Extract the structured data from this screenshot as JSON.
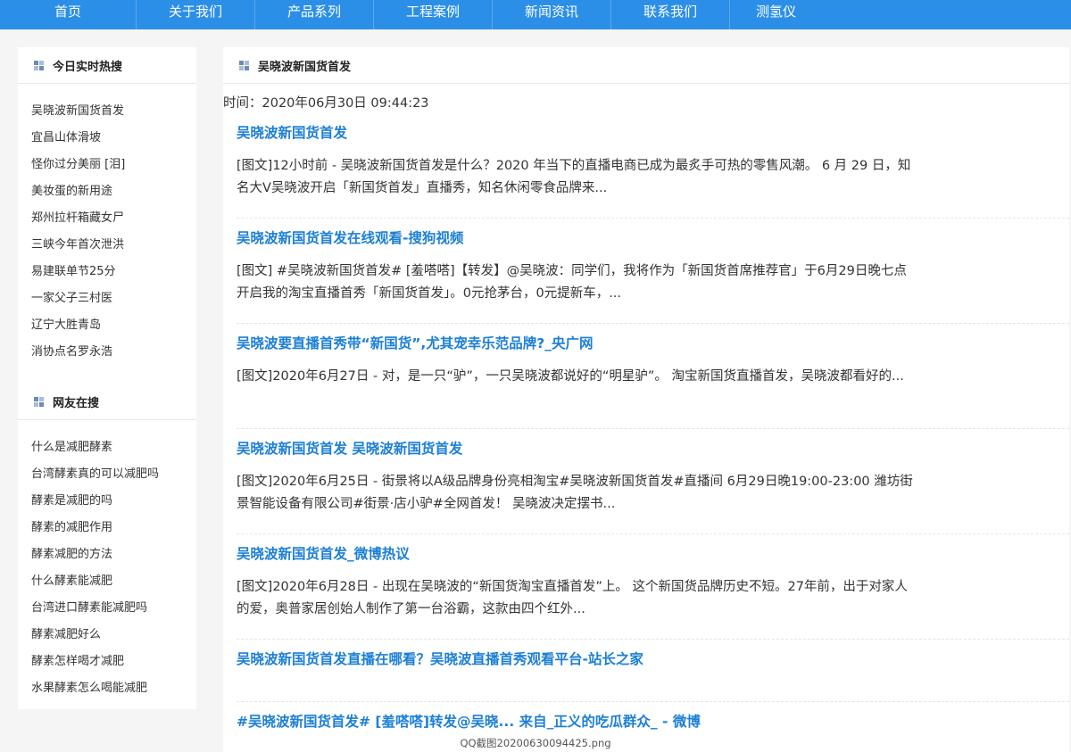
{
  "nav": {
    "items": [
      "首页",
      "关于我们",
      "产品系列",
      "工程案例",
      "新闻资讯",
      "联系我们",
      "测氢仪"
    ]
  },
  "sidebar": {
    "hot_title": "今日实时热搜",
    "hot_items": [
      "吴晓波新国货首发",
      "宜昌山体滑坡",
      "怪你过分美丽 [泪]",
      "美妆蛋的新用途",
      "郑州拉杆箱藏女尸",
      "三峡今年首次泄洪",
      "易建联单节25分",
      "一家父子三村医",
      "辽宁大胜青岛",
      "消协点名罗永浩"
    ],
    "search_title": "网友在搜",
    "search_items": [
      "什么是减肥酵素",
      "台湾酵素真的可以减肥吗",
      "酵素是减肥的吗",
      "酵素的减肥作用",
      "酵素减肥的方法",
      "什么酵素能减肥",
      "台湾进口酵素能减肥吗",
      "酵素减肥好么",
      "酵素怎样喝才减肥",
      "水果酵素怎么喝能减肥"
    ]
  },
  "main": {
    "title": "吴晓波新国货首发",
    "time": "时间：2020年06月30日 09:44:23",
    "results": [
      {
        "title": "吴晓波新国货首发",
        "snippet": "[图文]12小时前 - 吴晓波新国货首发是什么？2020 年当下的直播电商已成为最炙手可热的零售风潮。 6 月 29 日，知名大V吴晓波开启「新国货首发」直播秀，知名休闲零食品牌来..."
      },
      {
        "title": "吴晓波新国货首发在线观看-搜狗视频",
        "snippet": "[图文] #吴晓波新国货首发# [羞嗒嗒]【转发】@吴晓波：同学们，我将作为「新国货首席推荐官」于6月29日晚七点开启我的淘宝直播首秀「新国货首发」。0元抢茅台，0元提新车，..."
      },
      {
        "title": "吴晓波要直播首秀带“新国货”,尤其宠幸乐范品牌?_央广网",
        "snippet": "[图文]2020年6月27日 - 对，是一只“驴”，一只吴晓波都说好的“明星驴”。 淘宝新国货直播首发，吴晓波都看好的..."
      },
      {
        "title": "吴晓波新国货首发 吴晓波新国货首发",
        "snippet": "[图文]2020年6月25日 - 街景将以A级品牌身份亮相淘宝#吴晓波新国货首发#直播间 6月29日晚19:00-23:00 潍坊街景智能设备有限公司#街景·店小驴#全网首发！ 吴晓波决定摆书..."
      },
      {
        "title": "吴晓波新国货首发_微博热议",
        "snippet": "[图文]2020年6月28日 - 出现在吴晓波的“新国货淘宝直播首发”上。 这个新国货品牌历史不短。27年前，出于对家人的爱，奥普家居创始人制作了第一台浴霸，这款由四个红外..."
      },
      {
        "title": "吴晓波新国货首发直播在哪看？吴晓波直播首秀观看平台-站长之家",
        "snippet": ""
      },
      {
        "title": "#吴晓波新国货首发# [羞嗒嗒]转发@吴晓... 来自_正义的吃瓜群众_ - 微博",
        "snippet": ""
      }
    ]
  },
  "caption": "QQ截图20200630094425.png"
}
